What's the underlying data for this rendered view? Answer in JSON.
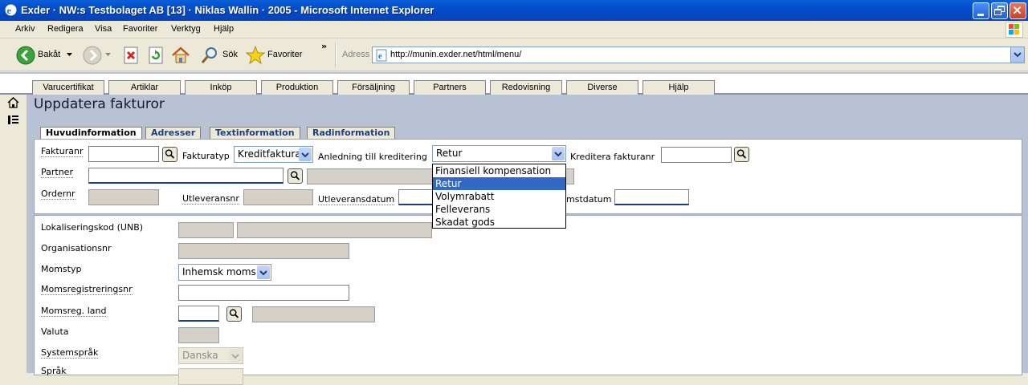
{
  "window": {
    "title": "Exder · NW:s Testbolaget AB [13] · Niklas Wallin · 2005 - Microsoft Internet Explorer"
  },
  "menu": [
    "Arkiv",
    "Redigera",
    "Visa",
    "Favoriter",
    "Verktyg",
    "Hjälp"
  ],
  "toolbar": {
    "back_label": "Bakåt",
    "search_label": "Sök",
    "favorites_label": "Favoriter",
    "address_label": "Adress",
    "url": "http://munin.exder.net/html/menu/"
  },
  "nav_tabs": [
    "Varucertifikat",
    "Artiklar",
    "Inköp",
    "Produktion",
    "Försäljning",
    "Partners",
    "Redovisning",
    "Diverse",
    "Hjälp"
  ],
  "page_title": "Uppdatera fakturor",
  "form_tabs": [
    "Huvudinformation",
    "Adresser",
    "Textinformation",
    "Radinformation"
  ],
  "form": {
    "fakturanr_label": "Fakturanr",
    "fakturatyp_label": "Fakturatyp",
    "fakturatyp_value": "Kreditfaktura",
    "anledning_label": "Anledning till kreditering",
    "anledning_value": "Retur",
    "anledning_options": [
      "Finansiell kompensation",
      "Retur",
      "Volymrabatt",
      "Felleverans",
      "Skadat gods"
    ],
    "kreditera_label": "Kreditera fakturanr",
    "partner_label": "Partner",
    "ordernr_label": "Ordernr",
    "utleveransnr_label": "Utleveransnr",
    "utleveransdatum_label": "Utleveransdatum",
    "momstdatum_label": "mstdatum",
    "lokaliseringskod_label": "Lokaliseringskod (UNB)",
    "organisationsnr_label": "Organisationsnr",
    "momstyp_label": "Momstyp",
    "momstyp_value": "Inhemsk moms",
    "momsregnr_label": "Momsregistreringsnr",
    "momsregland_label": "Momsreg. land",
    "valuta_label": "Valuta",
    "systemsprak_label": "Systemspråk",
    "systemsprak_value": "Danska",
    "sprak_label": "Språk"
  }
}
